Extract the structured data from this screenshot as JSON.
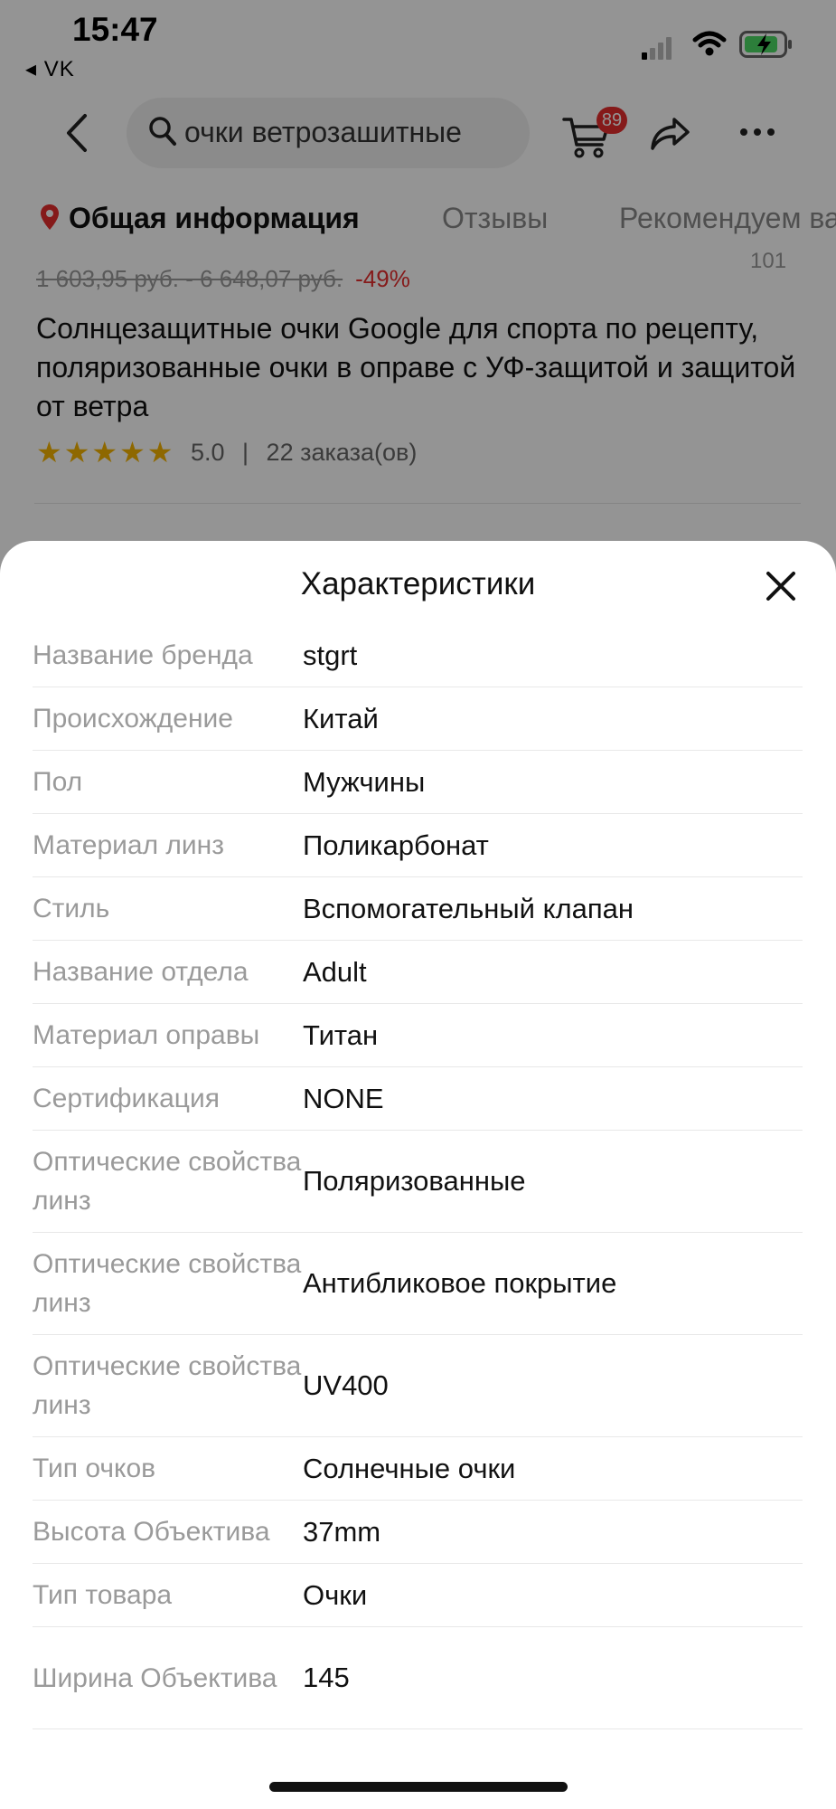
{
  "status_bar": {
    "time": "15:47",
    "back_app": "◂ VK"
  },
  "nav": {
    "search_text": "очки ветрозашитные",
    "cart_badge": "89"
  },
  "tabs": {
    "items": [
      "Общая информация",
      "Отзывы",
      "Рекомендуем ва"
    ]
  },
  "product": {
    "price_old": "1 603,95 руб. - 6 648,07 руб.",
    "discount": "-49%",
    "tiny_right": "101",
    "title": "Солнцезащитные очки Google для спорта по рецепту, поляризованные очки в оправе с УФ-защитой и защитой от ветра",
    "rating_score": "5.0",
    "rating_sep": "|",
    "orders": "22 заказа(ов)"
  },
  "sheet": {
    "title": "Характеристики",
    "rows": [
      {
        "key": "Название бренда",
        "value": "stgrt"
      },
      {
        "key": "Происхождение",
        "value": "Китай"
      },
      {
        "key": "Пол",
        "value": "Мужчины"
      },
      {
        "key": "Материал линз",
        "value": "Поликарбонат"
      },
      {
        "key": "Стиль",
        "value": "Вспомогательный клапан"
      },
      {
        "key": "Название отдела",
        "value": "Adult"
      },
      {
        "key": "Материал оправы",
        "value": "Титан"
      },
      {
        "key": "Сертификация",
        "value": "NONE"
      },
      {
        "key": "Оптические свойства линз",
        "value": "Поляризованные"
      },
      {
        "key": "Оптические свойства линз",
        "value": "Антибликовое покрытие"
      },
      {
        "key": "Оптические свойства линз",
        "value": "UV400"
      },
      {
        "key": "Тип очков",
        "value": "Солнечные очки"
      },
      {
        "key": "Высота Объектива",
        "value": "37mm"
      },
      {
        "key": "Тип товара",
        "value": "Очки"
      },
      {
        "key": "Ширина Объектива",
        "value": "145"
      }
    ]
  },
  "colors": {
    "accent_red": "#e62e2e",
    "star": "#f5b400",
    "battery_green": "#4cd964"
  }
}
